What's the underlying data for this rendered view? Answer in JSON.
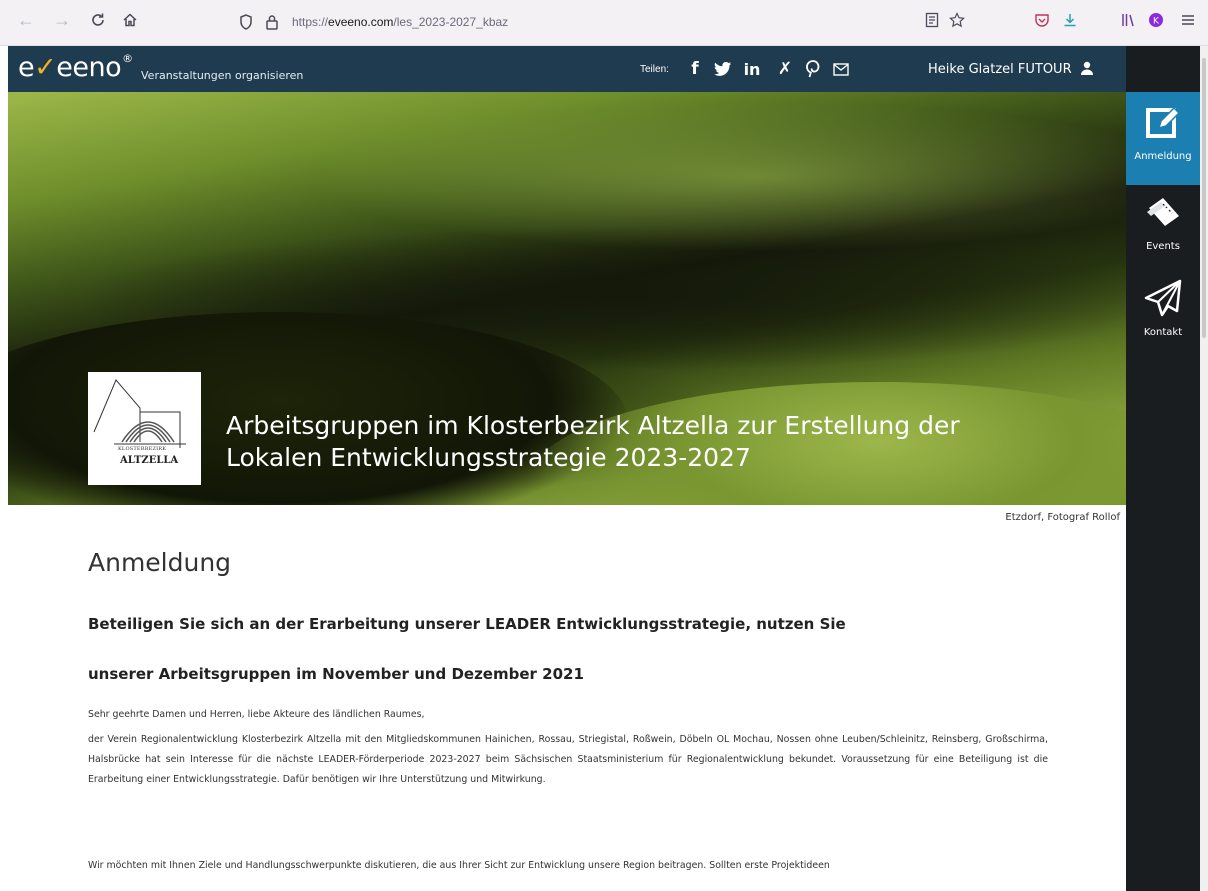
{
  "browser": {
    "url_prefix": "https://",
    "url_domain": "eveeno.com",
    "url_path": "/les_2023-2027_kbaz"
  },
  "header": {
    "logo_text_pre": "e",
    "logo_text_post": "eeno",
    "logo_reg": "®",
    "tagline": "Veranstaltungen organisieren",
    "share_label": "Teilen:",
    "user_name": "Heike Glatzel FUTOUR"
  },
  "sidebar": {
    "items": [
      {
        "label": "Anmeldung",
        "icon": "edit-icon",
        "active": true
      },
      {
        "label": "Events",
        "icon": "tickets-icon",
        "active": false
      },
      {
        "label": "Kontakt",
        "icon": "paper-plane-icon",
        "active": false
      }
    ]
  },
  "hero": {
    "logo_line1": "KLOSTERBEZIRK",
    "logo_line2": "ALTZELLA",
    "title_line1": "Arbeitsgruppen im Klosterbezirk Altzella zur Erstellung der",
    "title_line2": "Lokalen Entwicklungsstrategie 2023-2027",
    "photo_credit": "Etzdorf, Fotograf Rollof"
  },
  "content": {
    "heading": "Anmeldung",
    "lead_line1": "Beteiligen Sie sich an der Erarbeitung unserer LEADER Entwicklungsstrategie, nutzen Sie",
    "lead_line2": "unserer Arbeitsgruppen im November und Dezember 2021",
    "greeting": "Sehr geehrte Damen und Herren, liebe Akteure des ländlichen Raumes,",
    "paragraph1": "der Verein Regionalentwicklung Klosterbezirk Altzella mit den Mitgliedskommunen Hainichen, Rossau, Striegistal, Roßwein, Döbeln OL Mochau, Nossen ohne Leuben/Schleinitz, Reinsberg, Großschirma, Halsbrücke hat sein Interesse für die nächste LEADER-Förderperiode 2023-2027 beim Sächsischen Staatsministerium für Regionalentwicklung bekundet. Voraussetzung für eine Beteiligung ist die Erarbeitung einer Entwicklungsstrategie. Dafür benötigen wir Ihre Unterstützung und Mitwirkung.",
    "paragraph2": "Wir möchten mit Ihnen Ziele und Handlungsschwerpunkte diskutieren, die aus Ihrer Sicht zur Entwicklung unsere Region beitragen. Sollten erste Projektideen"
  },
  "colors": {
    "header_bg": "#1f3b4f",
    "sidebar_bg": "#1a1d20",
    "sidebar_active": "#1c7fb1",
    "logo_accent": "#f4b223"
  }
}
